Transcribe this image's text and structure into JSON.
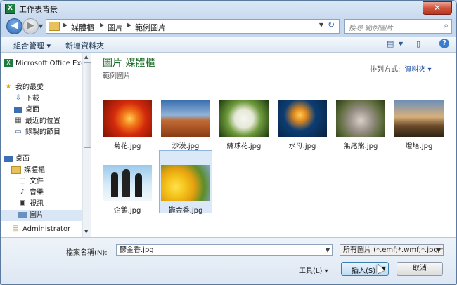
{
  "window": {
    "title": "工作表背景",
    "close_icon": "✕"
  },
  "address": {
    "crumbs": [
      "媒體櫃",
      "圖片",
      "範例圖片"
    ],
    "search_placeholder": "搜尋 範例圖片"
  },
  "toolbar": {
    "organize": "組合管理 ▾",
    "new_folder": "新增資料夾"
  },
  "nav": {
    "items": [
      {
        "label": "Microsoft Office Excel",
        "icon": "excel-icon"
      },
      {
        "label": "我的最愛",
        "icon": "star-icon"
      },
      {
        "label": "下載",
        "icon": "download-icon"
      },
      {
        "label": "桌面",
        "icon": "desktop-icon"
      },
      {
        "label": "最近的位置",
        "icon": "recent-icon"
      },
      {
        "label": "錄製的節目",
        "icon": "tv-icon"
      },
      {
        "label": "桌面",
        "icon": "desktop-icon"
      },
      {
        "label": "媒體櫃",
        "icon": "library-icon"
      },
      {
        "label": "文件",
        "icon": "document-icon"
      },
      {
        "label": "音樂",
        "icon": "music-icon"
      },
      {
        "label": "視訊",
        "icon": "video-icon"
      },
      {
        "label": "圖片",
        "icon": "picture-icon"
      },
      {
        "label": "Administrator",
        "icon": "user-icon"
      }
    ]
  },
  "content": {
    "heading": "圖片 媒體櫃",
    "subheading": "範例圖片",
    "arrange_label": "排列方式:",
    "arrange_value": "資料夾 ▾",
    "thumbnails": [
      {
        "name": "菊花.jpg"
      },
      {
        "name": "沙漠.jpg"
      },
      {
        "name": "繡球花.jpg"
      },
      {
        "name": "水母.jpg"
      },
      {
        "name": "無尾熊.jpg"
      },
      {
        "name": "燈塔.jpg"
      },
      {
        "name": "企鵝.jpg"
      },
      {
        "name": "鬱金香.jpg"
      }
    ]
  },
  "bottom": {
    "filename_label": "檔案名稱(N):",
    "filename_value": "鬱金香.jpg",
    "filetype": "所有圖片 (*.emf;*.wmf;*.jpg;*.j",
    "tools": "工具(L)  ▾",
    "insert": "插入(S)",
    "cancel": "取消"
  }
}
